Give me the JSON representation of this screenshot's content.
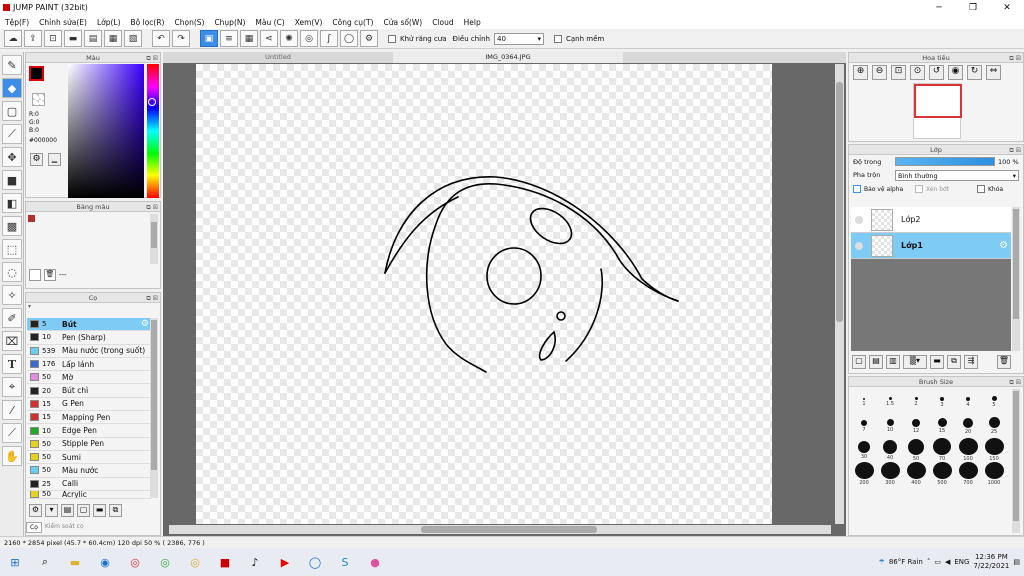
{
  "window": {
    "title": "JUMP PAINT (32bit)"
  },
  "menu": [
    "Tệp(F)",
    "Chỉnh sửa(E)",
    "Lớp(L)",
    "Bộ lọc(R)",
    "Chọn(S)",
    "Chụp(N)",
    "Màu (C)",
    "Xem(V)",
    "Công cụ(T)",
    "Cửa sổ(W)",
    "Cloud",
    "Help"
  ],
  "toolbar": {
    "antialias_label": "Khử răng cưa",
    "correction_label": "Điều chỉnh",
    "correction_value": "40",
    "sharp_edge_label": "Cạnh mềm"
  },
  "color_panel": {
    "title": "Màu",
    "r": "R:0",
    "g": "G:0",
    "b": "B:0",
    "hex": "#000000",
    "primary": "#000000",
    "hue_indicator": "blue"
  },
  "palette_panel": {
    "title": "Bảng màu",
    "swatch": "#b03030",
    "count": "---"
  },
  "brush_panel": {
    "title": "Cọ",
    "brushes": [
      {
        "size": "5",
        "name": "Bút",
        "color": "#222222",
        "selected": true
      },
      {
        "size": "10",
        "name": "Pen (Sharp)",
        "color": "#222222"
      },
      {
        "size": "539",
        "name": "Màu nước (trong suốt)",
        "color": "#6ad0f0"
      },
      {
        "size": "176",
        "name": "Lấp lánh",
        "color": "#3a6ad0"
      },
      {
        "size": "50",
        "name": "Mờ",
        "color": "#e28ee0"
      },
      {
        "size": "20",
        "name": "Bút chì",
        "color": "#222222"
      },
      {
        "size": "15",
        "name": "G Pen",
        "color": "#d43030"
      },
      {
        "size": "15",
        "name": "Mapping Pen",
        "color": "#d43030"
      },
      {
        "size": "10",
        "name": "Edge Pen",
        "color": "#22aa22"
      },
      {
        "size": "50",
        "name": "Stipple Pen",
        "color": "#e8d020"
      },
      {
        "size": "50",
        "name": "Sumi",
        "color": "#e8d020"
      },
      {
        "size": "50",
        "name": "Màu nước",
        "color": "#6ad0f0"
      },
      {
        "size": "25",
        "name": "Calli",
        "color": "#222222"
      },
      {
        "size": "50",
        "name": "Acrylic",
        "color": "#e8d020"
      }
    ],
    "bottom_tabs": [
      "Cọ",
      "Kiểm soát cọ"
    ]
  },
  "canvas": {
    "tabs": [
      "Untitled",
      "IMG_0364.JPG"
    ]
  },
  "navigator": {
    "title": "Hoa tiêu"
  },
  "layers_panel": {
    "title": "Lớp",
    "opacity_label": "Độ trong",
    "opacity_value": "100 %",
    "opacity_fraction": 1.0,
    "blend_label": "Pha trộn",
    "blend_value": "Bình thường",
    "protect_alpha": "Bảo vệ alpha",
    "clip": "Xén bớt",
    "lock": "Khóa",
    "layers": [
      {
        "name": "Lớp2",
        "selected": false
      },
      {
        "name": "Lớp1",
        "selected": true
      }
    ]
  },
  "brush_size_panel": {
    "title": "Brush Size",
    "sizes": [
      "1",
      "1.5",
      "2",
      "3",
      "4",
      "5",
      "7",
      "10",
      "12",
      "15",
      "20",
      "25",
      "30",
      "40",
      "50",
      "70",
      "100",
      "150",
      "200",
      "300",
      "400",
      "500",
      "700",
      "1000"
    ]
  },
  "status": {
    "text": "2160 * 2854 pixel  (45.7 * 60.4cm)  120 dpi  50 %  ( 2386, 776 )"
  },
  "taskbar": {
    "weather": "86°F Rain",
    "lang": "ENG",
    "time": "12:36 PM",
    "date": "7/22/2021"
  }
}
